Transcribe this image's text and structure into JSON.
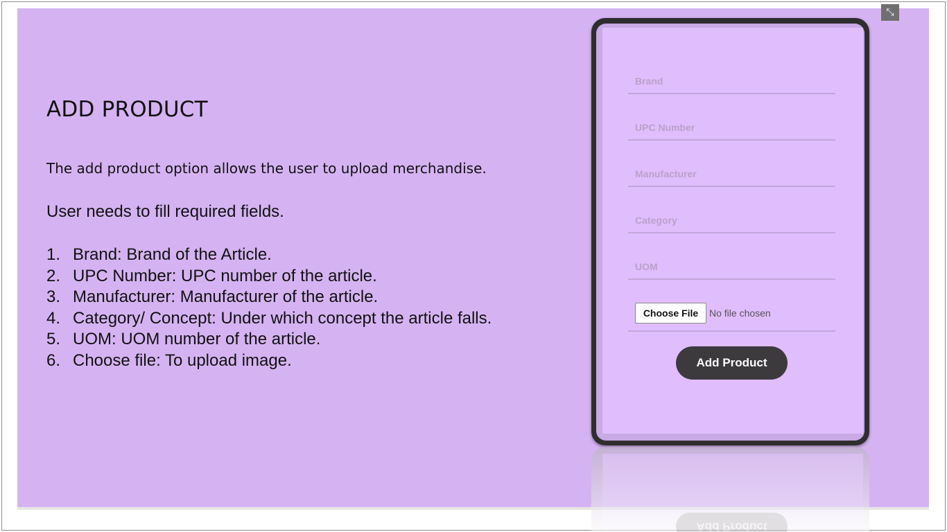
{
  "slide": {
    "title": "ADD PRODUCT",
    "description": "The add product option allows the user to upload merchandise.",
    "required_note": "User needs to fill required fields.",
    "steps": [
      {
        "num": "1.",
        "text": "Brand: Brand of the Article."
      },
      {
        "num": "2.",
        "text": "UPC Number: UPC number of the article."
      },
      {
        "num": "3.",
        "text": "Manufacturer: Manufacturer of the article."
      },
      {
        "num": "4.",
        "text": "Category/ Concept: Under which concept the article falls."
      },
      {
        "num": "5.",
        "text": "UOM: UOM number of the article."
      },
      {
        "num": "6.",
        "text": "Choose file: To upload image."
      }
    ]
  },
  "form": {
    "fields": [
      {
        "placeholder": "Brand"
      },
      {
        "placeholder": "UPC Number"
      },
      {
        "placeholder": "Manufacturer"
      },
      {
        "placeholder": "Category"
      },
      {
        "placeholder": "UOM"
      }
    ],
    "choose_file_label": "Choose File",
    "no_file_text": "No file chosen",
    "submit_label": "Add Product"
  },
  "controls": {
    "exit_fullscreen_icon": "exit-fullscreen-icon",
    "exit_fullscreen_glyph": "⤡"
  },
  "colors": {
    "slide_background": "#d5b3f2",
    "screen_background": "#e0bdfd",
    "button": "#3d3a3e"
  }
}
